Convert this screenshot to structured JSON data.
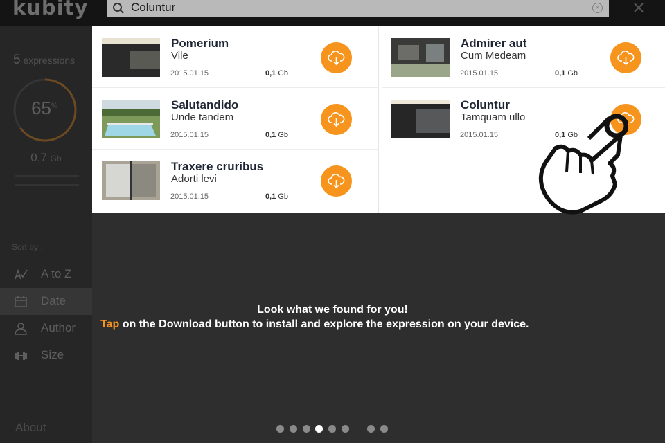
{
  "app": {
    "logo": "kubity"
  },
  "search": {
    "query": "Coluntur",
    "icon": "search-icon"
  },
  "sidebar": {
    "expressions_count": "5",
    "expressions_label": "expressions",
    "ring_value": "65",
    "ring_unit": "%",
    "ring_fraction": 0.65,
    "size_value": "0,7",
    "size_unit": "Gb",
    "sort_by_label": "Sort by :",
    "sort_items": [
      {
        "label": "A to Z",
        "icon": "sort-alpha-icon",
        "active": false
      },
      {
        "label": "Date",
        "icon": "calendar-icon",
        "active": true
      },
      {
        "label": "Author",
        "icon": "person-icon",
        "active": false
      },
      {
        "label": "Size",
        "icon": "dumbbell-icon",
        "active": false
      }
    ],
    "about_label": "About"
  },
  "results": [
    {
      "title": "Pomerium",
      "subtitle": "Vile",
      "date": "2015.01.15",
      "size_value": "0,1",
      "size_unit": "Gb"
    },
    {
      "title": "Admirer aut",
      "subtitle": "Cum Medeam",
      "date": "2015.01.15",
      "size_value": "0,1",
      "size_unit": "Gb"
    },
    {
      "title": "Salutandido",
      "subtitle": "Unde tandem",
      "date": "2015.01.15",
      "size_value": "0,1",
      "size_unit": "Gb"
    },
    {
      "title": "Coluntur",
      "subtitle": "Tamquam ullo",
      "date": "2015.01.15",
      "size_value": "0,1",
      "size_unit": "Gb"
    },
    {
      "title": "Traxere cruribus",
      "subtitle": "Adorti levi",
      "date": "2015.01.15",
      "size_value": "0,1",
      "size_unit": "Gb"
    }
  ],
  "tutorial": {
    "line1": "Look what we found for you!",
    "tap_word": "Tap",
    "line2_rest": " on the Download button to install and explore the expression on your device."
  },
  "pagination": {
    "total": 8,
    "current_index": 3
  },
  "colors": {
    "accent": "#f7941d",
    "panel_bg": "#ffffff",
    "overlay_bg": "#2e2e2e"
  }
}
